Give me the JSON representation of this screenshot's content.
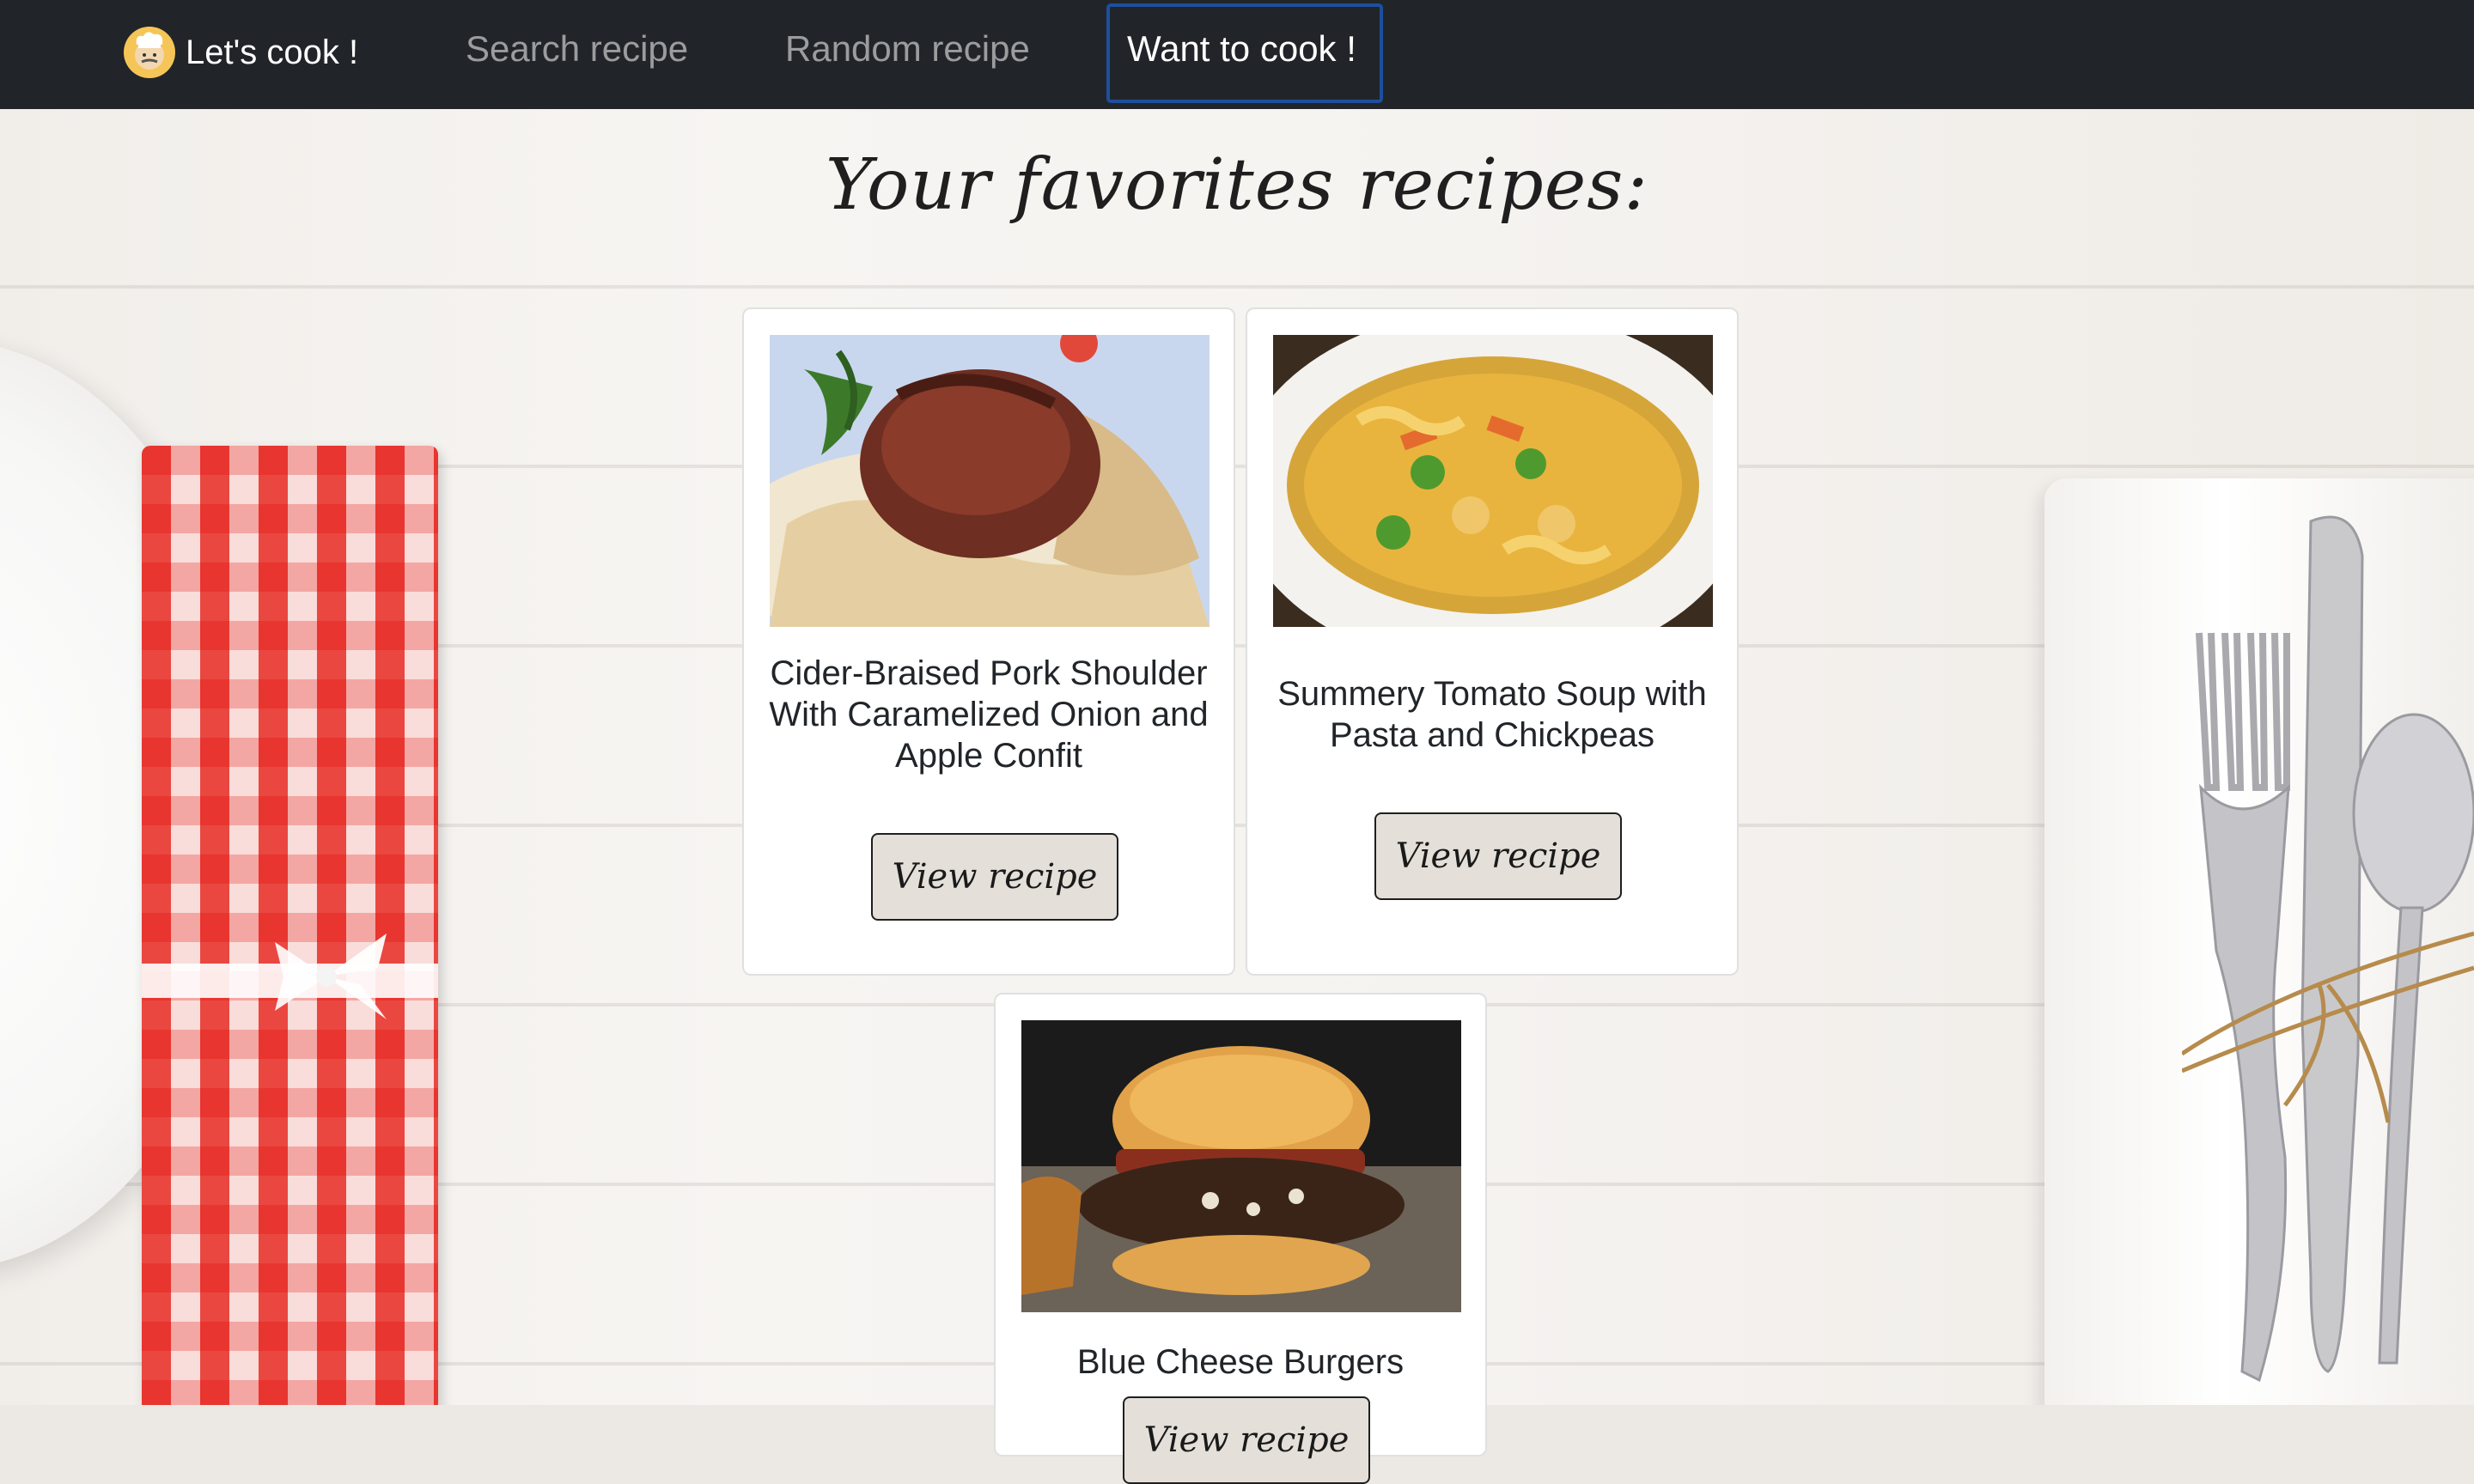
{
  "nav": {
    "brand_label": "Let's cook !",
    "links": [
      {
        "label": "Search recipe",
        "active": false
      },
      {
        "label": "Random recipe",
        "active": false
      },
      {
        "label": "Want to cook !",
        "active": true
      }
    ],
    "background": "#212529",
    "active_outline": "#1d4f9e"
  },
  "page": {
    "title": "Your favorites recipes:"
  },
  "recipes": [
    {
      "title": "Cider-Braised Pork Shoulder With Caramelized Onion and Apple Confit",
      "button_label": "View recipe",
      "image": "braised-pork-photo"
    },
    {
      "title": "Summery Tomato Soup with Pasta and Chickpeas",
      "button_label": "View recipe",
      "image": "tomato-soup-photo"
    },
    {
      "title": "Blue Cheese Burgers",
      "button_label": "View recipe",
      "image": "burger-photo"
    }
  ],
  "colors": {
    "button_bg": "#e4dfd9",
    "napkin_red": "#e53b33"
  }
}
